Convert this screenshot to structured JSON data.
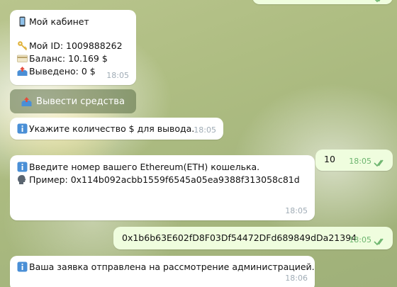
{
  "messages": {
    "cabinet": {
      "title": "Мой кабинет",
      "id_line": "Мой ID: 1009888262",
      "balance_line": "Баланс: 10.169 $",
      "withdrawn_line": "Выведено: 0 $",
      "time": "18:05"
    },
    "withdraw_button": "Вывести средства",
    "ask_amount": {
      "text": "Укажите количество $ для вывода.",
      "time": "18:05"
    },
    "user_amount": {
      "text": "10",
      "time": "18:05"
    },
    "ask_wallet": {
      "text": "Введите номер вашего Ethereum(ETH) кошелька.",
      "example": "Пример: 0x114b092acbb1559f6545a05ea9388f313058c81d",
      "time": "18:05"
    },
    "user_wallet": {
      "text": "0x1b6b63E602fD8F03Df54472DFd689849dDa21394",
      "time": "18:05"
    },
    "confirm": {
      "text": "Ваша заявка отправлена на рассмотрение администрацией.",
      "time": "18:06"
    }
  },
  "colors": {
    "incoming_bubble": "#ffffff",
    "outgoing_bubble": "#effdde",
    "read_ticks": "#6cb46e",
    "info_icon": "#4a8fd6"
  },
  "icons": {
    "phone": "mobile-phone-icon",
    "key": "key-icon",
    "card": "credit-card-icon",
    "outbox": "outbox-tray-icon",
    "info": "info-icon",
    "speaking_head": "speaking-head-icon",
    "read": "double-check-icon"
  }
}
